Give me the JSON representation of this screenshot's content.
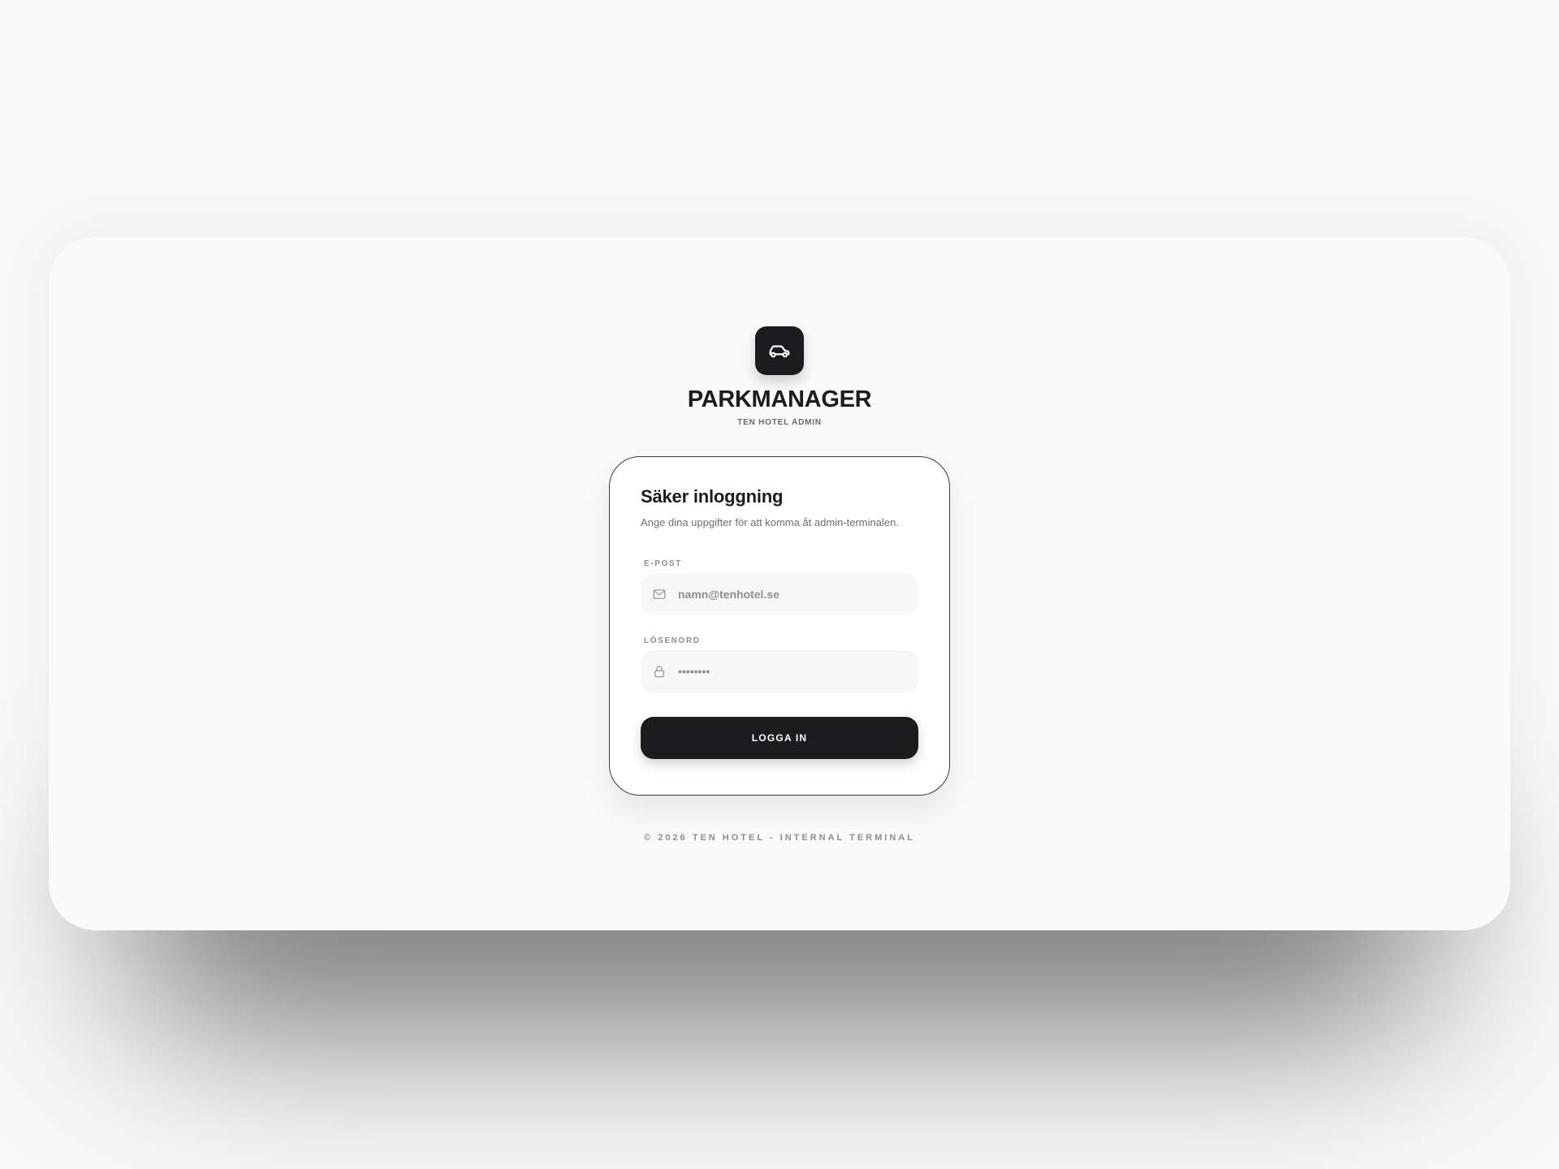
{
  "brand": {
    "icon": "car-icon",
    "title": "PARKMANAGER",
    "subtitle": "TEN HOTEL ADMIN"
  },
  "login": {
    "title": "Säker inloggning",
    "description": "Ange dina uppgifter för att komma åt admin-terminalen.",
    "email": {
      "label": "E-POST",
      "placeholder": "namn@tenhotel.se",
      "icon": "mail-icon"
    },
    "password": {
      "label": "LÖSENORD",
      "value": "••••••••",
      "icon": "lock-icon"
    },
    "submit_label": "LOGGA IN"
  },
  "footer": {
    "text": "© 2026 TEN HOTEL - INTERNAL TERMINAL"
  },
  "colors": {
    "primary": "#1c1c1e",
    "muted": "#8e8e93",
    "background": "#fafafa"
  }
}
